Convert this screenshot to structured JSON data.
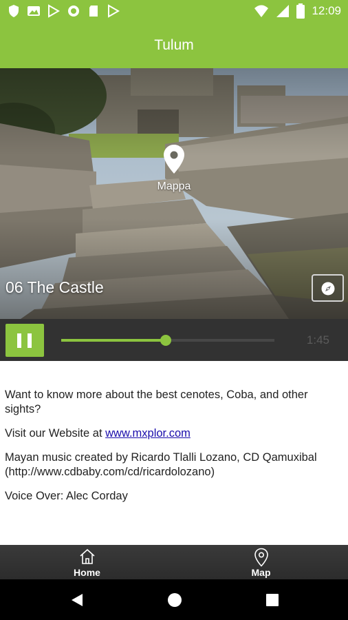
{
  "status_bar": {
    "time": "12:09",
    "left_icons": [
      "shield-icon",
      "image-icon",
      "play-store-icon",
      "circle-icon",
      "sd-card-icon",
      "play-store-icon"
    ],
    "right_icons": [
      "wifi-icon",
      "signal-icon",
      "battery-icon"
    ]
  },
  "app_bar": {
    "title": "Tulum"
  },
  "hero": {
    "map_label": "Mappa",
    "track_title": "06 The Castle"
  },
  "player": {
    "progress": 0.49,
    "time_label": "1:45",
    "state": "playing"
  },
  "content": {
    "paragraph1": "Want to know more about the best cenotes, Coba, and other sights?",
    "visit_prefix": "Visit our Website at ",
    "website_link": "www.mxplor.com",
    "credits": "Mayan music created by Ricardo Tlalli Lozano, CD Qamuxibal (http://www.cdbaby.com/cd/ricardolozano)",
    "voice_over": "Voice Over: Alec Corday"
  },
  "bottom_nav": {
    "home_label": "Home",
    "map_label": "Map"
  },
  "colors": {
    "accent": "#8cc43f",
    "player_bg": "#323232",
    "nav_bg": "#2c2c2c",
    "link": "#1a0dab"
  }
}
